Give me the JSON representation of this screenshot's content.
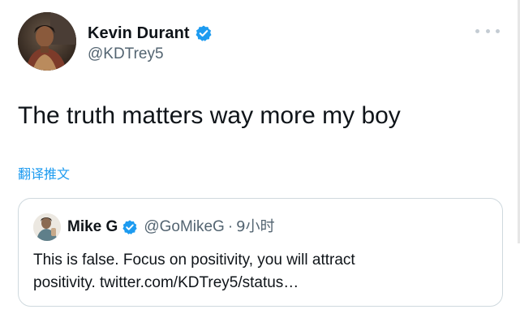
{
  "tweet": {
    "author_name": "Kevin Durant",
    "author_handle": "@KDTrey5",
    "text": "The truth matters way more my boy",
    "translate_label": "翻译推文",
    "verified": true
  },
  "quote": {
    "author_name": "Mike G",
    "author_handle": "@GoMikeG",
    "separator": "·",
    "time": "9小时",
    "text_line1": "This is false. Focus on positivity, you will attract",
    "text_line2": "positivity. twitter.com/KDTrey5/status…",
    "verified": true
  },
  "icons": {
    "verified": "verified-badge-icon",
    "more": "more-dots-icon"
  },
  "colors": {
    "accent": "#1d9bf0",
    "text_primary": "#0f1419",
    "text_secondary": "#536471",
    "border": "#cfd9de",
    "background": "#ffffff"
  }
}
